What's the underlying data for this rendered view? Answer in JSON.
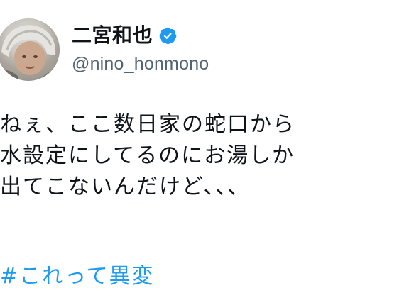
{
  "tweet": {
    "author": {
      "display_name": "二宮和也",
      "handle": "@nino_honmono",
      "verified": true,
      "verified_icon": "verified-badge-icon",
      "verified_color": "#1d9bf0"
    },
    "text_lines": [
      "ねぇ、ここ数日家の蛇口から",
      "水設定にしてるのにお湯しか",
      "出てこないんだけど、、、"
    ],
    "hashtag": "#これって異変"
  },
  "colors": {
    "text": "#0f1419",
    "secondary": "#536471",
    "accent": "#1d9bf0",
    "background": "#ffffff"
  }
}
